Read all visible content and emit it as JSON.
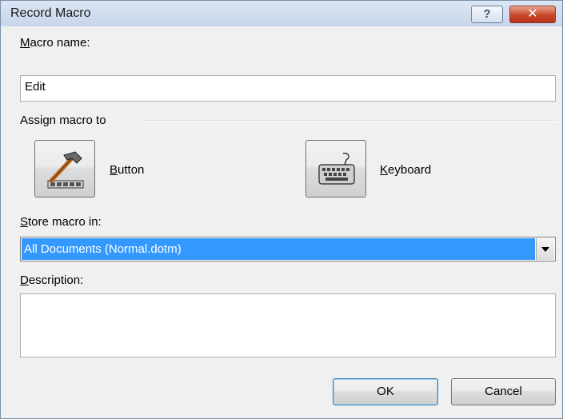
{
  "window": {
    "title": "Record Macro",
    "help_glyph": "?",
    "close_glyph": "✕"
  },
  "macro_name": {
    "label_hotkey": "M",
    "label_rest": "acro name:",
    "value": "Edit"
  },
  "assign": {
    "group_label": "Assign macro to",
    "button": {
      "label_hotkey": "B",
      "label_rest": "utton",
      "icon": "hammer-toolbar-icon"
    },
    "keyboard": {
      "label_hotkey": "K",
      "label_rest": "eyboard",
      "icon": "keyboard-icon"
    }
  },
  "store": {
    "label_hotkey": "S",
    "label_rest": "tore macro in:",
    "selected": "All Documents (Normal.dotm)"
  },
  "description": {
    "label_hotkey": "D",
    "label_rest": "escription:",
    "value": ""
  },
  "actions": {
    "ok_label": "OK",
    "cancel_label": "Cancel"
  },
  "colors": {
    "selection": "#3399ff",
    "close_button": "#c9482a",
    "titlebar": "#c7d6ea"
  }
}
